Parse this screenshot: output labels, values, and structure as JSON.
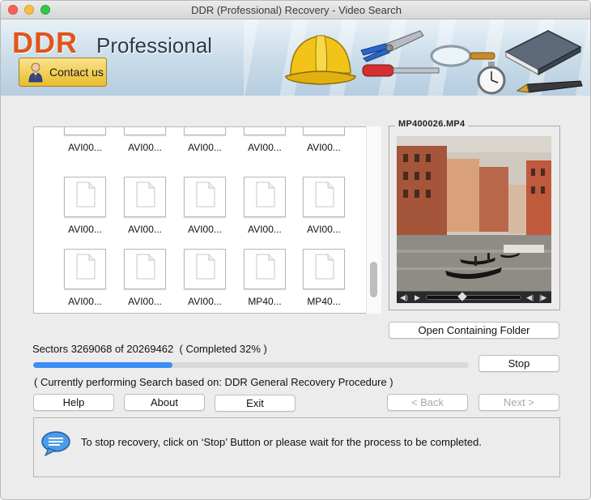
{
  "window": {
    "title": "DDR (Professional) Recovery - Video Search"
  },
  "banner": {
    "logo_ddr": "DDR",
    "logo_professional": "Professional",
    "contact_label": "Contact us"
  },
  "files": [
    {
      "name": "AVI00..."
    },
    {
      "name": "AVI00..."
    },
    {
      "name": "AVI00..."
    },
    {
      "name": "AVI00..."
    },
    {
      "name": "AVI00..."
    },
    {
      "name": "AVI00..."
    },
    {
      "name": "AVI00..."
    },
    {
      "name": "AVI00..."
    },
    {
      "name": "AVI00..."
    },
    {
      "name": "AVI00..."
    },
    {
      "name": "AVI00..."
    },
    {
      "name": "AVI00..."
    },
    {
      "name": "AVI00..."
    },
    {
      "name": "MP40..."
    },
    {
      "name": "MP40..."
    }
  ],
  "preview": {
    "filename": "MP400026.MP4",
    "open_folder_label": "Open Containing Folder"
  },
  "progress": {
    "sectors_label": "Sectors",
    "sectors_done": "3269068",
    "of_label": "of",
    "sectors_total": "20269462",
    "completed_text": "( Completed 32% )",
    "fraction": 0.32,
    "stop_label": "Stop",
    "procedure_text": "( Currently performing Search based on: DDR General Recovery Procedure )"
  },
  "buttons": {
    "help": "Help",
    "about": "About",
    "exit": "Exit",
    "back": "< Back",
    "next": "Next >"
  },
  "message": {
    "text": "To stop recovery, click on ‘Stop’ Button or please wait for the process to be completed."
  },
  "colors": {
    "progress_fill": "#3c8df6",
    "logo_ddr": "#e2541b",
    "contact_button": "#f3cf55"
  }
}
